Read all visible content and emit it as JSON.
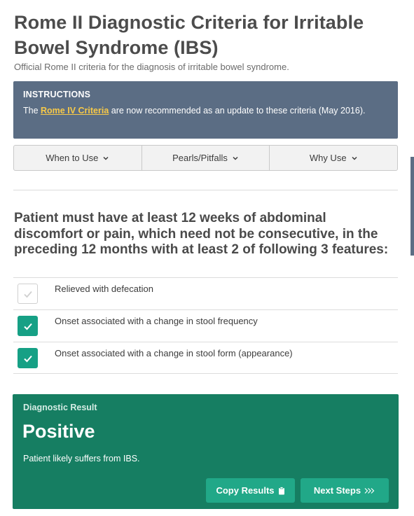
{
  "header": {
    "title": "Rome II Diagnostic Criteria for Irritable Bowel Syndrome (IBS)",
    "subtitle": "Official Rome II criteria for the diagnosis of irritable bowel syndrome."
  },
  "instructions": {
    "heading": "INSTRUCTIONS",
    "text_before": "The ",
    "link_text": "Rome IV Criteria",
    "text_after": " are now recommended as an update to these criteria (May 2016)."
  },
  "tabs": [
    {
      "label": "When to Use",
      "icon": "chevron-down-icon"
    },
    {
      "label": "Pearls/Pitfalls",
      "icon": "chevron-down-icon"
    },
    {
      "label": "Why Use",
      "icon": "chevron-down-icon"
    }
  ],
  "question": {
    "text": "Patient must have at least 12 weeks of abdominal discomfort or pain, which need not be consecutive, in the preceding 12 months with at least 2 of following 3 features:"
  },
  "criteria": [
    {
      "label": "Relieved with defecation",
      "checked": false
    },
    {
      "label": "Onset associated with a change in stool frequency",
      "checked": true
    },
    {
      "label": "Onset associated with a change in stool form (appearance)",
      "checked": true
    }
  ],
  "result": {
    "heading": "Diagnostic Result",
    "value": "Positive",
    "description": "Patient likely suffers from IBS.",
    "copy_label": "Copy Results",
    "next_label": "Next Steps"
  },
  "colors": {
    "instructions_bg": "#5b6d84",
    "link": "#f7c948",
    "checked": "#16a085",
    "result_bg": "#167e62",
    "button_bg": "#21a888"
  }
}
